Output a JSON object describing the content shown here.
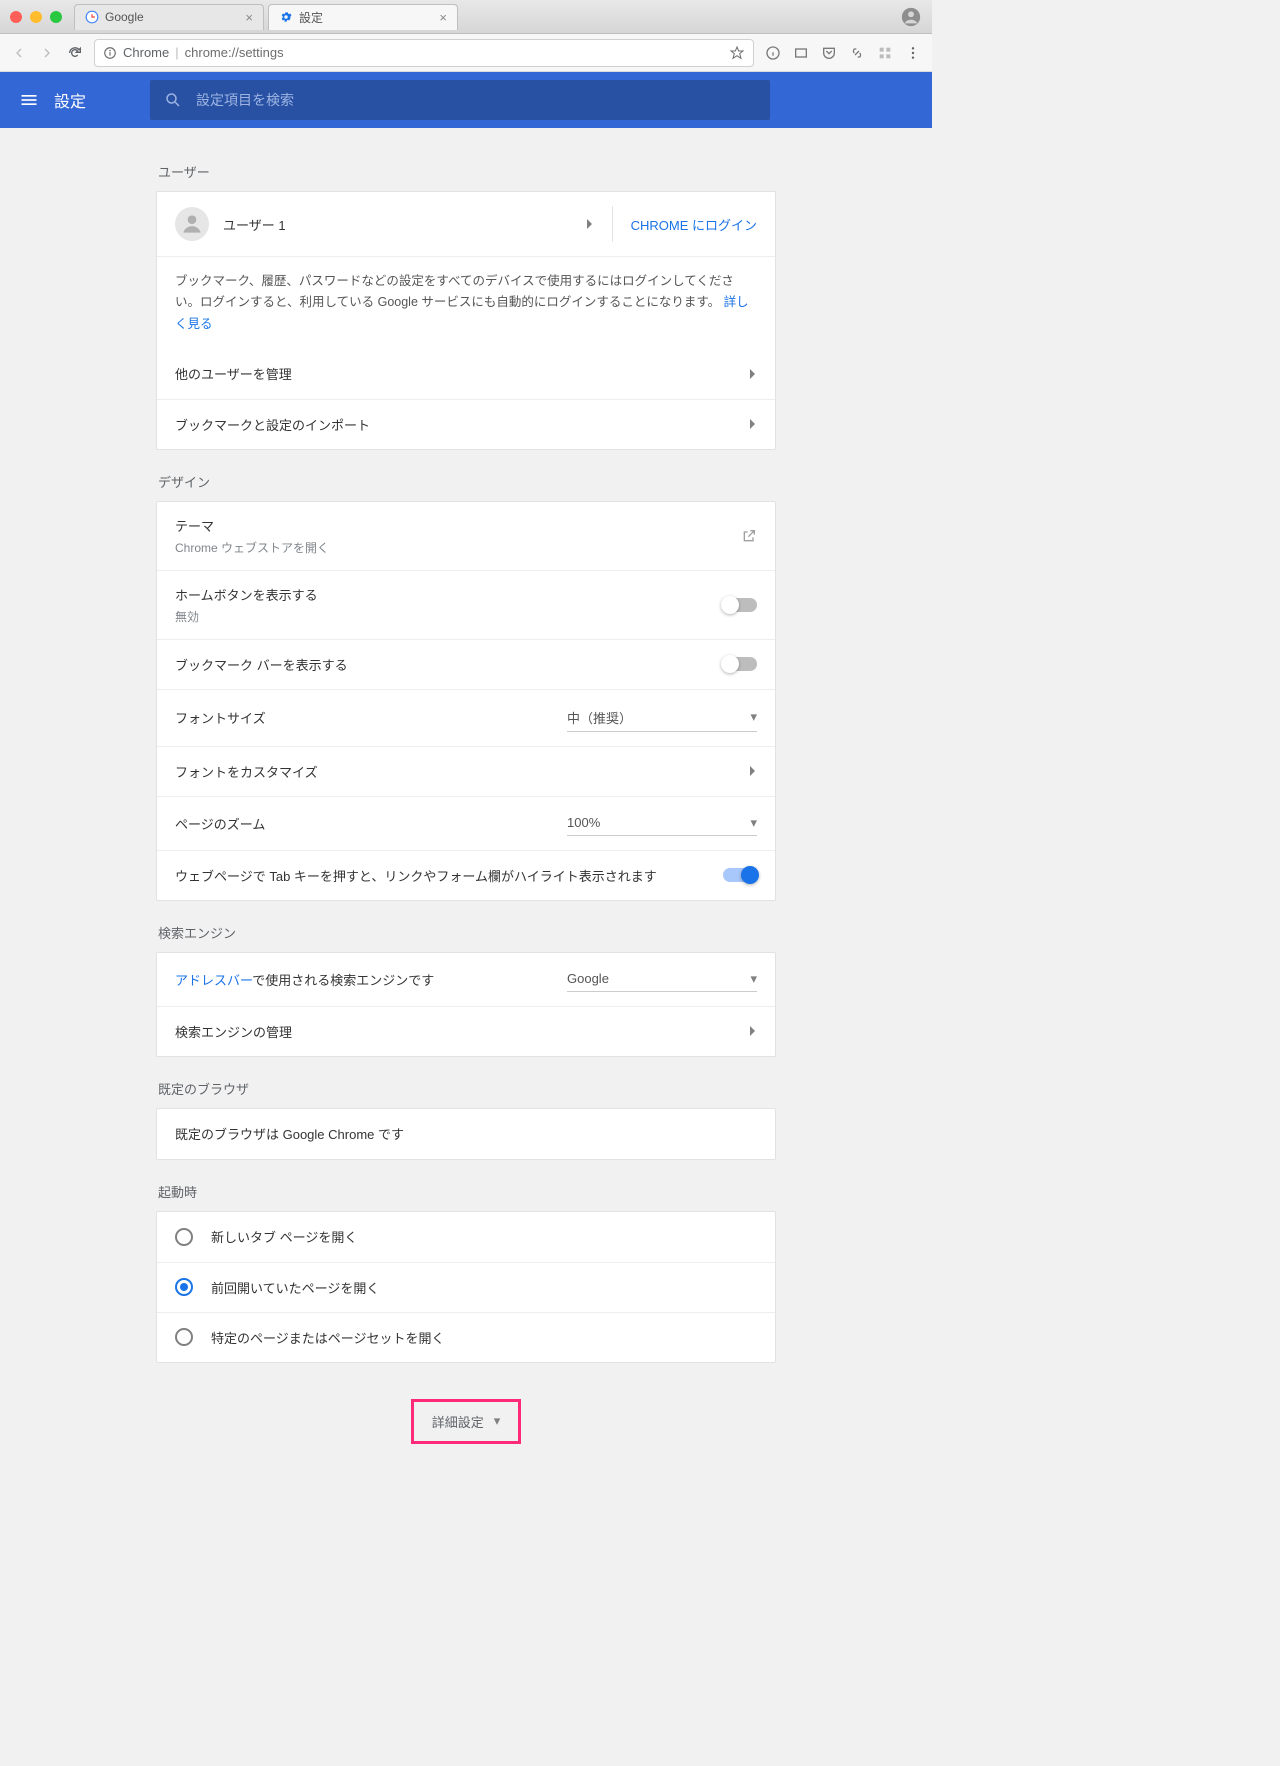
{
  "browser": {
    "tabs": [
      {
        "title": "Google"
      },
      {
        "title": "設定"
      }
    ],
    "omnibox": {
      "label": "Chrome",
      "url": "chrome://settings"
    }
  },
  "header": {
    "title": "設定",
    "search_placeholder": "設定項目を検索"
  },
  "sections": {
    "user": {
      "title": "ユーザー",
      "profile_name": "ユーザー 1",
      "login_label": "CHROME にログイン",
      "sync_text": "ブックマーク、履歴、パスワードなどの設定をすべてのデバイスで使用するにはログインしてください。ログインすると、利用している Google サービスにも自動的にログインすることになります。",
      "more_link": "詳しく見る",
      "manage_others": "他のユーザーを管理",
      "import": "ブックマークと設定のインポート"
    },
    "design": {
      "title": "デザイン",
      "theme_label": "テーマ",
      "theme_sub": "Chrome ウェブストアを開く",
      "homebtn_label": "ホームボタンを表示する",
      "homebtn_sub": "無効",
      "bookmark_bar": "ブックマーク バーを表示する",
      "fontsize_label": "フォントサイズ",
      "fontsize_value": "中（推奨）",
      "font_custom": "フォントをカスタマイズ",
      "zoom_label": "ページのズーム",
      "zoom_value": "100%",
      "tab_highlight": "ウェブページで Tab キーを押すと、リンクやフォーム欄がハイライト表示されます"
    },
    "search": {
      "title": "検索エンジン",
      "addrbar_prefix": "アドレスバー",
      "addrbar_suffix": "で使用される検索エンジンです",
      "engine_value": "Google",
      "manage": "検索エンジンの管理"
    },
    "default": {
      "title": "既定のブラウザ",
      "text": "既定のブラウザは Google Chrome です"
    },
    "startup": {
      "title": "起動時",
      "options": [
        "新しいタブ ページを開く",
        "前回開いていたページを開く",
        "特定のページまたはページセットを開く"
      ],
      "selected": 1
    }
  },
  "advanced_label": "詳細設定"
}
